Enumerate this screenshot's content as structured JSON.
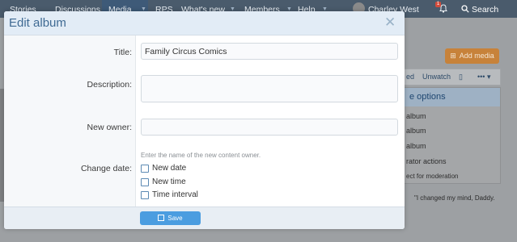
{
  "nav": {
    "items": [
      "Stories",
      "Discussions",
      "Media",
      "RPS",
      "What's new",
      "Members",
      "Help"
    ],
    "user": "Charley West",
    "notification_count": "1",
    "search": "Search"
  },
  "background": {
    "add_media": "Add media",
    "watch_items": [
      "ed",
      "Unwatch"
    ],
    "menu_title": "e options",
    "menu_items": [
      "album",
      "album",
      "album",
      "rator actions",
      "ect for moderation"
    ],
    "comic_caption": "\"I changed my mind, Daddy."
  },
  "modal": {
    "title": "Edit album",
    "fields": {
      "title_label": "Title:",
      "title_value": "Family Circus Comics",
      "description_label": "Description:",
      "description_value": "",
      "owner_label": "New owner:",
      "owner_value": "",
      "owner_hint": "Enter the name of the new content owner.",
      "change_date_label": "Change date:",
      "options": [
        "New date",
        "New time",
        "Time interval"
      ]
    },
    "save_label": "Save"
  },
  "colors": {
    "accent": "#4b9de0",
    "header": "#3f6a93",
    "add_media": "#c7823a"
  }
}
